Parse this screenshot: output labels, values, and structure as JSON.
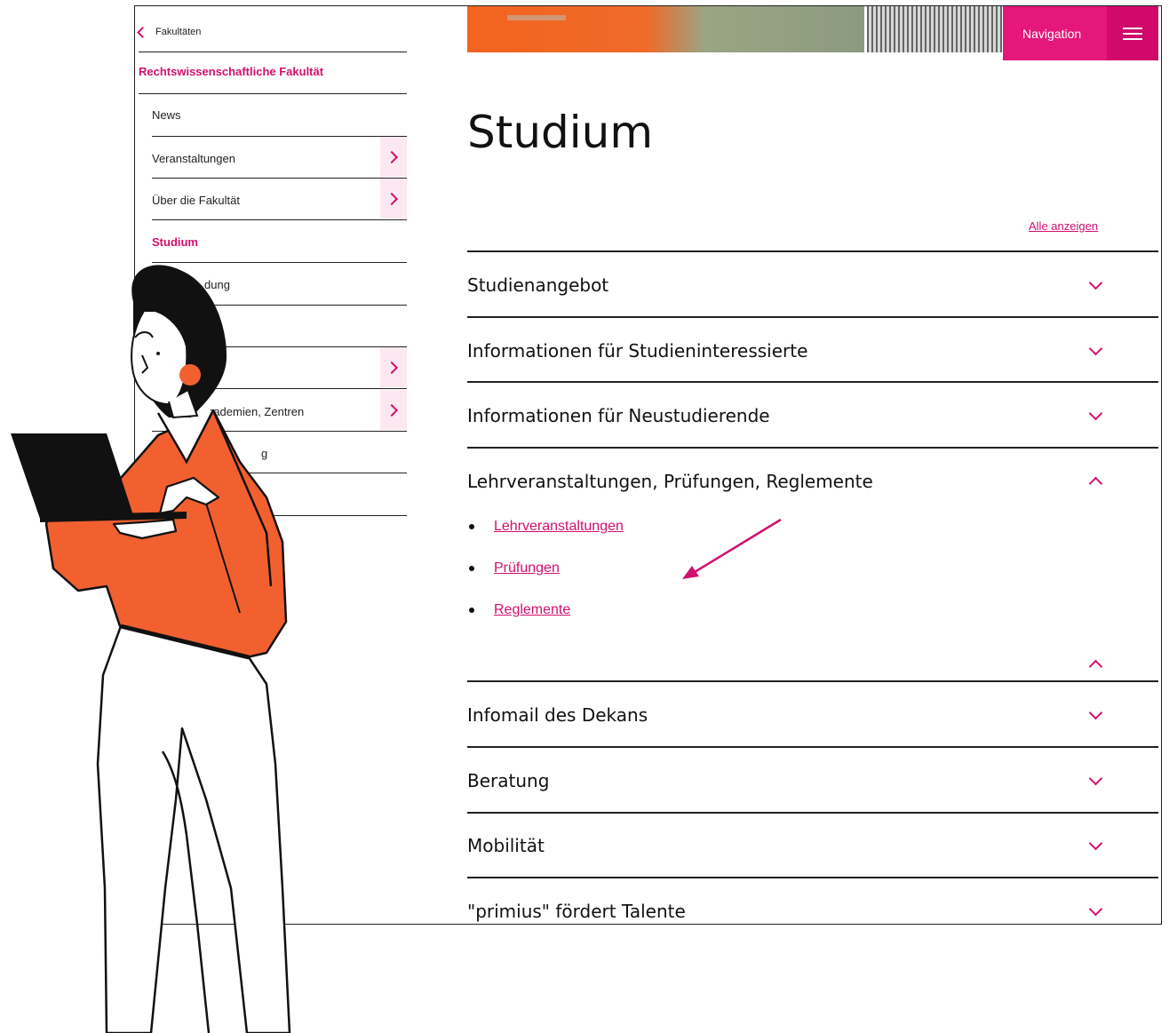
{
  "sidebar": {
    "back_label": "Fakultäten",
    "faculty": "Rechtswissenschaftliche Fakultät",
    "items": [
      {
        "label": "News"
      },
      {
        "label": "Veranstaltungen"
      },
      {
        "label": "Über die Fakultät"
      },
      {
        "label": "Studium"
      },
      {
        "label": "dung"
      },
      {
        "label": "rademien, Zentren"
      },
      {
        "label": "g"
      }
    ]
  },
  "header": {
    "nav_label": "Navigation"
  },
  "main": {
    "title": "Studium",
    "show_all": "Alle anzeigen",
    "sections": [
      {
        "title": "Studienangebot"
      },
      {
        "title": "Informationen für Studieninteressierte"
      },
      {
        "title": "Informationen für Neustudierende"
      },
      {
        "title": "Lehrveranstaltungen, Prüfungen, Reglemente",
        "links": [
          "Lehrveranstaltungen",
          "Prüfungen",
          "Reglemente"
        ]
      },
      {
        "title": "Infomail des Dekans"
      },
      {
        "title": "Beratung"
      },
      {
        "title": "Mobilität"
      },
      {
        "title": "\"primius\" fördert Talente"
      }
    ]
  },
  "colors": {
    "accent": "#e5177b",
    "accent_dark": "#d0096b",
    "illustration_orange": "#f26030"
  }
}
